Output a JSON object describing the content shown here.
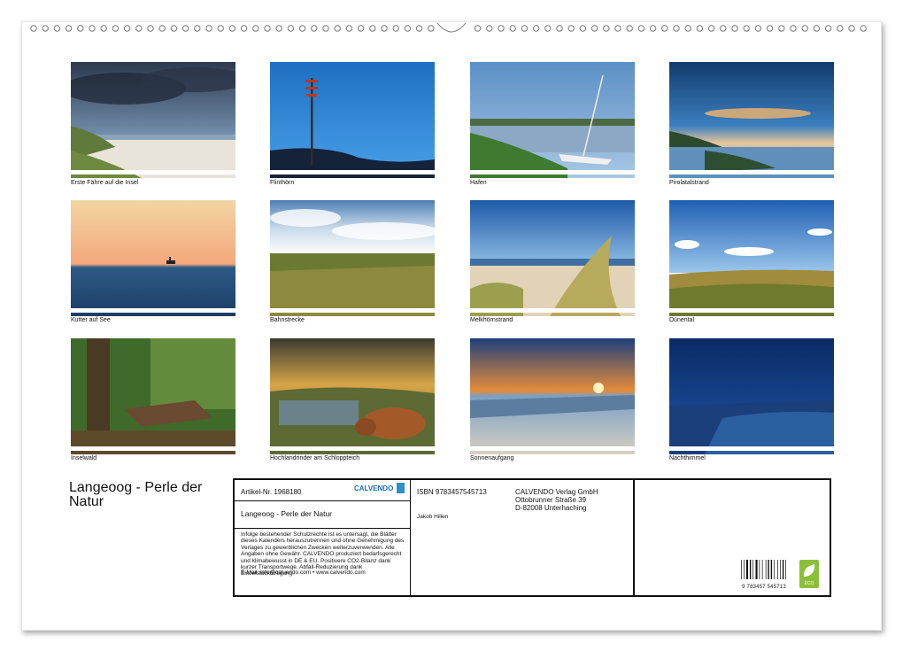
{
  "tiles": [
    {
      "caption": "Erste Fähre auf die Insel"
    },
    {
      "caption": "Flinthörn"
    },
    {
      "caption": "Hafen"
    },
    {
      "caption": "Pirolatalstrand"
    },
    {
      "caption": "Kutter auf See"
    },
    {
      "caption": "Bahnstrecke"
    },
    {
      "caption": "Melkhörnstrand"
    },
    {
      "caption": "Dünental"
    },
    {
      "caption": "Inselwald"
    },
    {
      "caption": "Hochlandrinder am Schloppteich"
    },
    {
      "caption": "Sonnenaufgang"
    },
    {
      "caption": "Nachthimmel"
    }
  ],
  "cover_title": "Langeoog - Perle der Natur",
  "info": {
    "article_no": "Artikel-Nr. 1968180",
    "logo_text": "CALVENDO",
    "title": "Langeoog - Perle der Natur",
    "legal_text": "Infolge bestehender Schutzrechte ist es untersagt, die Blätter dieses Kalenders herauszutrennen und ohne Genehmigung des Verlages zu gewerblichen Zwecken weiterzuverwenden. Alle Angaben ohne Gewähr. CALVENDO produziert bedarfsgerecht und klimabewusst in DE & EU. Positivere CO2-Bilanz dank kurzer Transportwege. Abfall-Reduzierung dank Einzelstückfertigung.",
    "contact": "E-Mail: info@calvendo.com • www.calvendo.com",
    "isbn": "ISBN 9783457545713",
    "author": "Jakob Hillen",
    "publisher": {
      "name": "CALVENDO Verlag GmbH",
      "street": "Ottobrunner Straße 39",
      "city": "D-82008 Unterhaching"
    },
    "barcode_number": "9 783457 545713",
    "eco_label": "ECO"
  }
}
